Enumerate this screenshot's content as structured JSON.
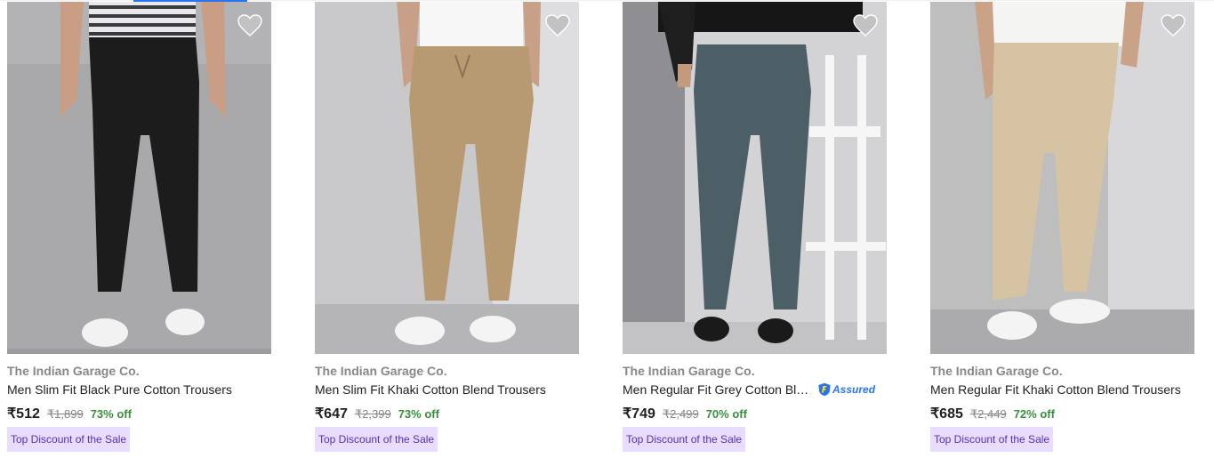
{
  "products": [
    {
      "brand": "The Indian Garage Co.",
      "title": "Men Slim Fit Black Pure Cotton Trousers",
      "price": "₹512",
      "mrp": "₹1,899",
      "discount": "73% off",
      "badge": "Top Discount of the Sale",
      "assured": false,
      "pants_color": "#1c1c1c",
      "bg_color": "#a9a9ac"
    },
    {
      "brand": "The Indian Garage Co.",
      "title": "Men Slim Fit Khaki Cotton Blend Trousers",
      "price": "₹647",
      "mrp": "₹2,399",
      "discount": "73% off",
      "badge": "Top Discount of the Sale",
      "assured": false,
      "pants_color": "#b89a72",
      "bg_color": "#c9c9cb"
    },
    {
      "brand": "The Indian Garage Co.",
      "title": "Men Regular Fit Grey Cotton Ble...",
      "price": "₹749",
      "mrp": "₹2,499",
      "discount": "70% off",
      "badge": "Top Discount of the Sale",
      "assured": true,
      "assured_label": "Assured",
      "pants_color": "#4c5f66",
      "bg_color": "#d3d3d5"
    },
    {
      "brand": "The Indian Garage Co.",
      "title": "Men Regular Fit Khaki Cotton Blend Trousers",
      "price": "₹685",
      "mrp": "₹2,449",
      "discount": "72% off",
      "badge": "Top Discount of the Sale",
      "assured": false,
      "pants_color": "#d6c3a3",
      "bg_color": "#bebebf"
    }
  ],
  "icons": {
    "wishlist": "heart-icon",
    "assured": "flipkart-assured-badge-icon"
  },
  "colors": {
    "accent": "#2874f0",
    "discount_green": "#388e3c",
    "badge_bg": "#e8dcff",
    "badge_text": "#5a2fb4",
    "muted_text": "#878787"
  }
}
